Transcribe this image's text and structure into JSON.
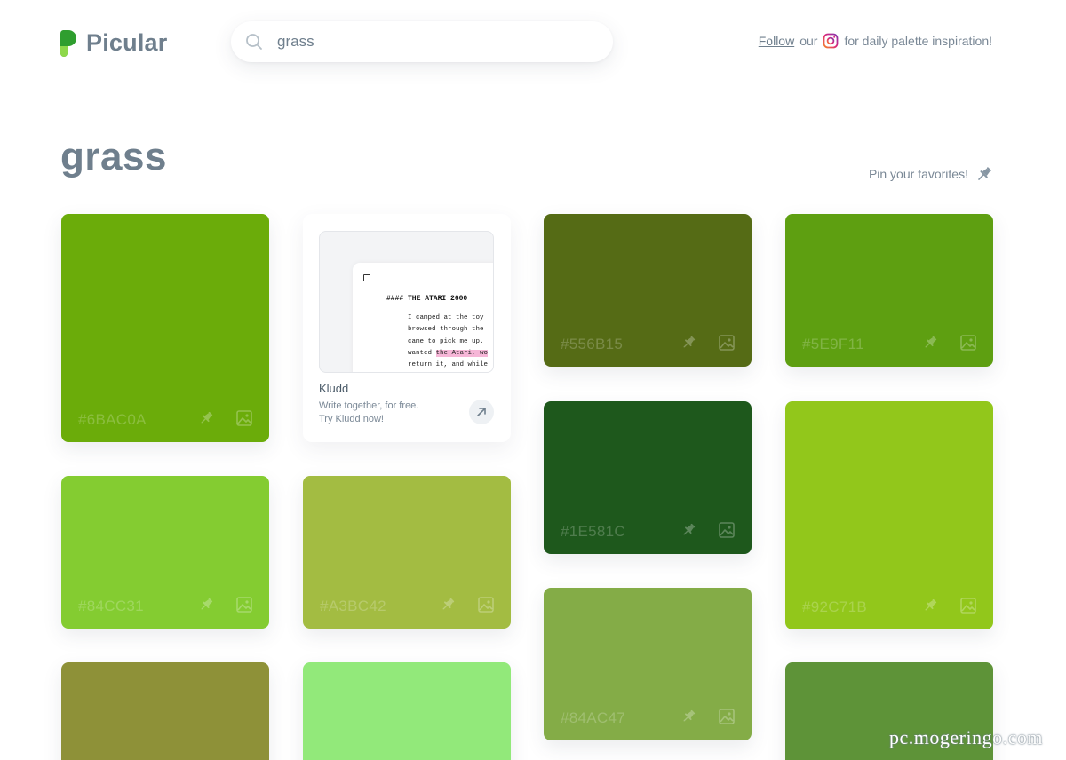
{
  "brand": {
    "name": "Picular"
  },
  "search": {
    "value": "grass",
    "placeholder": ""
  },
  "follow": {
    "link_text": "Follow",
    "middle_text": "our",
    "trailing_text": "for daily palette inspiration!",
    "icon": "instagram-icon"
  },
  "page": {
    "title": "grass"
  },
  "pin_favorites": {
    "label": "Pin your favorites!",
    "icon": "pin-icon"
  },
  "swatches": [
    {
      "hex": "#6BAC0A",
      "color": "#6BAC0A"
    },
    {
      "hex": "#556B15",
      "color": "#556B15"
    },
    {
      "hex": "#5E9F11",
      "color": "#5E9F11"
    },
    {
      "hex": "#1E581C",
      "color": "#1E581C"
    },
    {
      "hex": "#84CC31",
      "color": "#84CC31"
    },
    {
      "hex": "#A3BC42",
      "color": "#A3BC42"
    },
    {
      "hex": "#92C71B",
      "color": "#92C71B"
    },
    {
      "hex": "#84AC47",
      "color": "#84AC47"
    },
    {
      "hex": "",
      "color": "#8E9138"
    },
    {
      "hex": "",
      "color": "#92E97A"
    },
    {
      "hex": "",
      "color": "#5E9338"
    }
  ],
  "ad": {
    "title": "Kludd",
    "line1": "Write together, for free.",
    "line2": "Try Kludd now!",
    "preview": {
      "heading": "#### THE ATARI 2600",
      "lines": [
        "I camped at the toy",
        "browsed through the",
        "came to pick me up.",
        "wanted ",
        "return it, and while"
      ],
      "highlight": "the Atari, wo"
    }
  },
  "watermark": "pc.mogeringo.com",
  "colors": {
    "text": "#6f7f8d",
    "ig_gradient": [
      "#f58529",
      "#dd2a7b",
      "#8134af"
    ],
    "logo_dark": "#2f9e2f",
    "logo_light": "#8ed84a"
  }
}
